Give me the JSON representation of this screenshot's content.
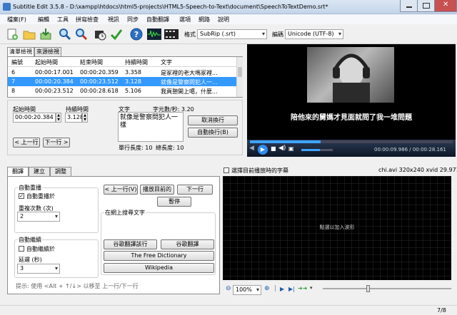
{
  "window": {
    "title": "Subtitle Edit 3.5.8 - D:\\xampp\\htdocs\\html5-projects\\HTML5-Speech-to-Text\\document\\SpeechToTextDemo.srt*"
  },
  "menu": [
    "檔案(F)",
    "編輯",
    "工具",
    "拼寫檢查",
    "視訊",
    "同步",
    "自動翻譯",
    "選項",
    "網路",
    "說明"
  ],
  "toolbar": {
    "icons": [
      "new-icon",
      "open-icon",
      "save-icon",
      "find-icon",
      "replace-icon",
      "visual-sync-icon",
      "spellcheck-icon",
      "help-icon",
      "waveform-icon",
      "video-icon"
    ],
    "format_label": "格式",
    "format_value": "SubRip (.srt)",
    "encoding_label": "編碼",
    "encoding_value": "Unicode (UTF-8)"
  },
  "list_tabs": [
    "清單檢視",
    "來源檢視"
  ],
  "grid": {
    "columns": [
      "編號",
      "起始時間",
      "結束時間",
      "持續時間",
      "文字"
    ],
    "rows": [
      [
        "6",
        "00:00:17.001",
        "00:00:20.359",
        "3.358",
        "是冢裡的老大嗎冢裡..."
      ],
      [
        "7",
        "00:00:20.384",
        "00:00:23.512",
        "3.128",
        "就像是警察問犯人一..."
      ],
      [
        "8",
        "00:00:23.512",
        "00:00:28.618",
        "5.106",
        "我頁憩開上噶，什麼..."
      ]
    ],
    "selected_index": 1
  },
  "editor": {
    "start_label": "起始時間",
    "start_value": "00:00:20.384",
    "duration_label": "持續時間",
    "duration_value": "3.128",
    "text_label": "文字",
    "cps_label": "字元數/秒: 3.20",
    "text_value": "就像是警察問犯人一樣",
    "single_line_length": "單行長度: 10",
    "total_length": "總長度: 10",
    "prev_button": "< 上一行",
    "next_button": "下一行 >",
    "unbreak_button": "取消換行",
    "autobreak_button": "自動換行(B)"
  },
  "video": {
    "subtitle": "陪他來的舅媽才見面就問了我一堆問題",
    "time": "00:00:09.986 / 00:00:28.161",
    "volume_fraction": 0.6,
    "progress_fraction": 0.35,
    "info": "chi.avi 320x240 xvid 29.971",
    "select_current_label": "選擇目前播放時的字幕",
    "waveform_hint": "點選以加入波形",
    "zoom_value": "100%",
    "position_fraction": 0.35
  },
  "bottom_tabs": [
    "翻譯",
    "建立",
    "調整"
  ],
  "translate": {
    "autorepeat_group": "自動重播",
    "autorepeat_check": "自動重播於",
    "repeat_count_label": "重複次數 (次)",
    "repeat_count_value": "2",
    "autocontinue_group": "自動繼續",
    "autocontinue_check": "自動繼續於",
    "delay_label": "延遲 (秒)",
    "delay_value": "3",
    "prev_line_button": "< 上一行(V)",
    "play_current_button": "播放目前的",
    "next_line_button": "下一行",
    "pause_button": "暫停",
    "search_label": "在網上搜尋文字",
    "google_line_button": "谷歌翻譯該行",
    "google_translate_button": "谷歌翻譯",
    "free_dictionary_button": "The Free Dictionary",
    "wikipedia_button": "Wikipedia",
    "hint": "提示: 使用 <Alt + ↑/↓> 以移至 上一行/下一行"
  },
  "status": {
    "position": "7/8"
  }
}
